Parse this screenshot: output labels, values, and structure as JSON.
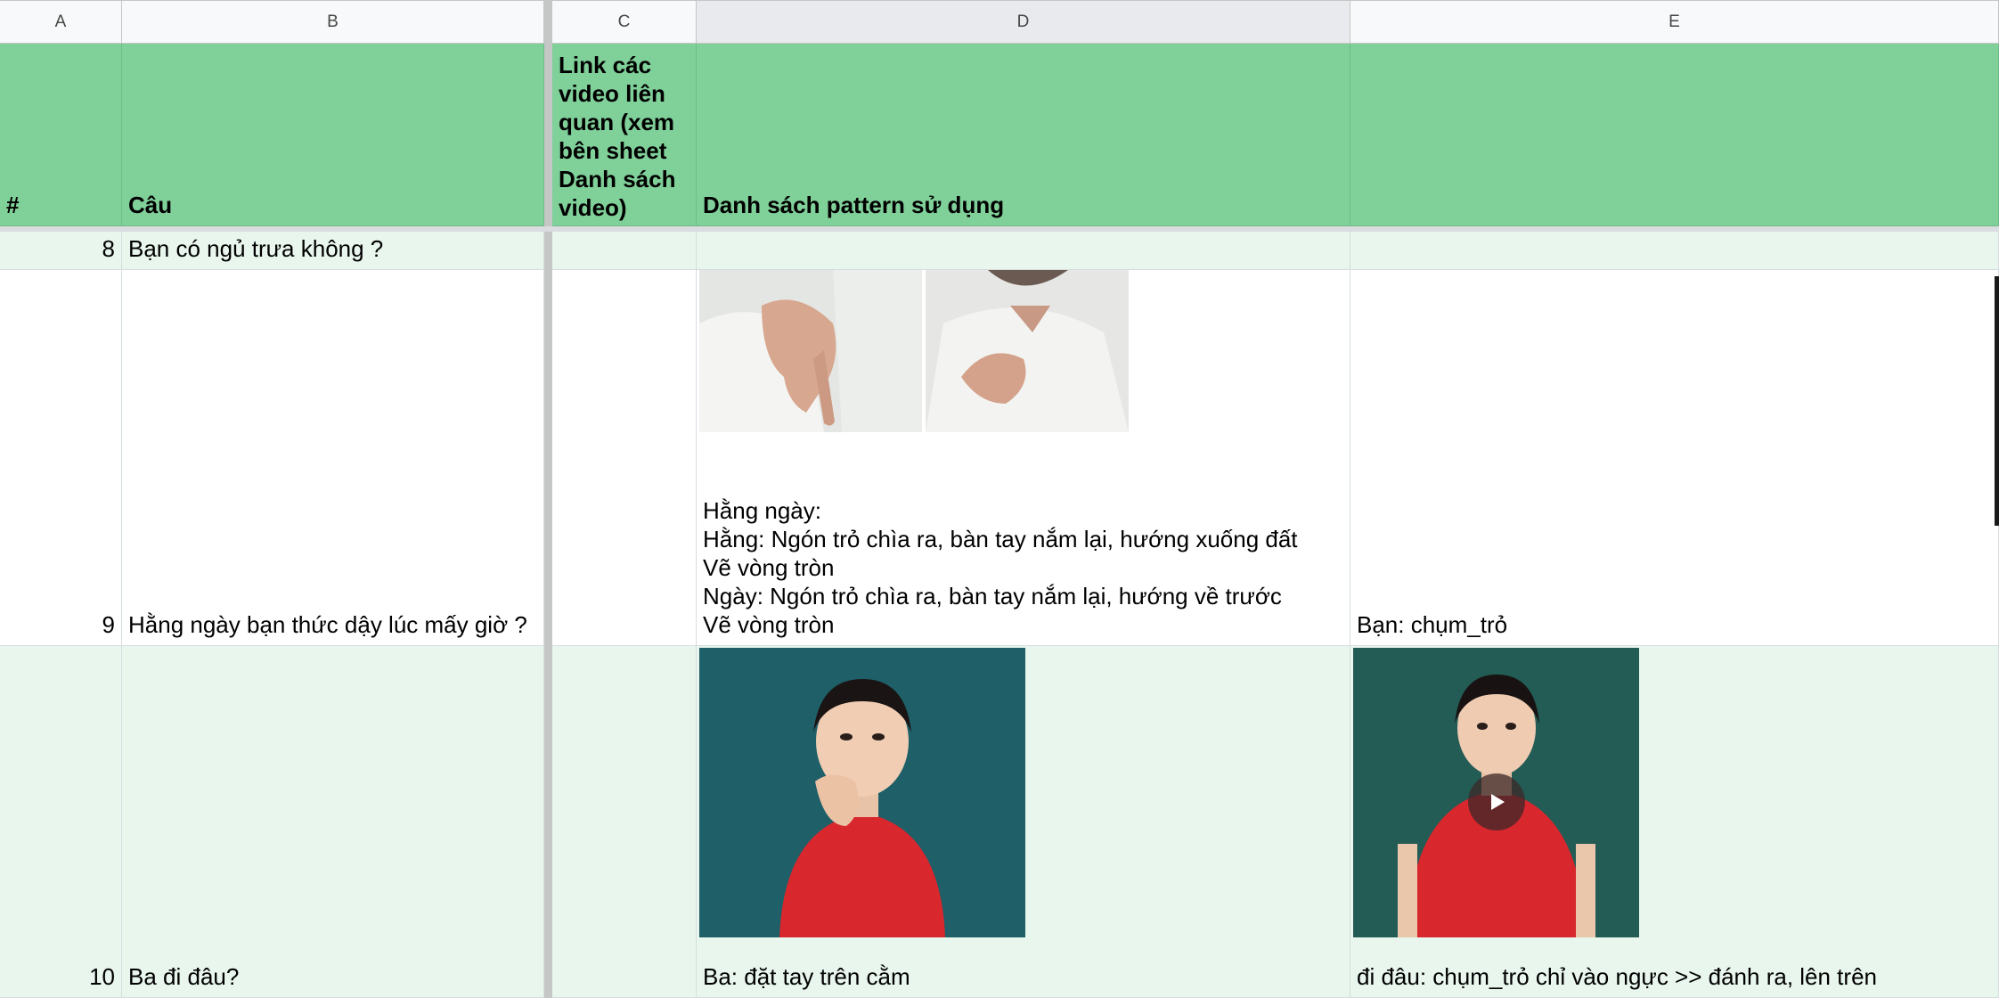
{
  "columns": [
    "A",
    "B",
    "C",
    "D",
    "E"
  ],
  "header": {
    "a": "#",
    "b": "Câu",
    "c": "Link các video liên quan (xem bên sheet Danh sách video)",
    "d": "Danh sách pattern sử dụng",
    "e": ""
  },
  "rows": [
    {
      "num": "8",
      "question": "Bạn có ngủ trưa không ?",
      "link": "",
      "pattern": "",
      "extra": ""
    },
    {
      "num": "9",
      "question": "Hằng ngày bạn thức dậy lúc mấy giờ ?",
      "link": "",
      "pattern": "Hằng ngày:\nHằng: Ngón trỏ chìa ra, bàn tay nắm lại, hướng xuống đất\nVẽ vòng tròn\nNgày: Ngón trỏ chìa ra, bàn tay nắm lại, hướng về trước\nVẽ vòng tròn",
      "extra": "Bạn: chụm_trỏ"
    },
    {
      "num": "10",
      "question": "Ba đi đâu?",
      "link": "",
      "pattern": "Ba: đặt tay trên cằm",
      "extra": "đi đâu: chụm_trỏ chỉ vào ngực >> đánh ra, lên trên"
    }
  ],
  "icons": {
    "play": "play-icon"
  },
  "colors": {
    "header_green": "#80d09a",
    "band_green": "#e8f6ee",
    "video_bg": "#1f5f68",
    "shirt_red": "#d8272d"
  }
}
